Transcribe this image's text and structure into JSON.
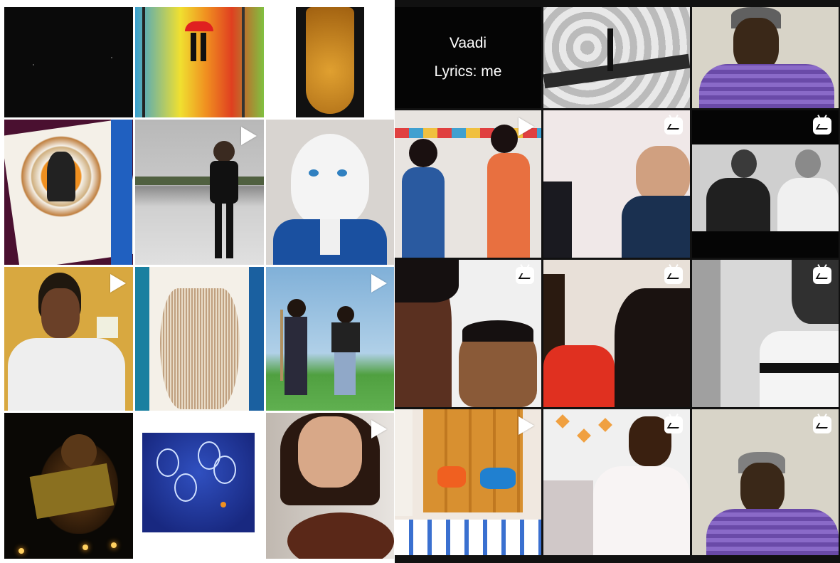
{
  "caption_tile": {
    "line1": "Vaadi",
    "line2": "Lyrics: me"
  },
  "left_tiles": [
    {
      "name": "dark-night-thumbnail",
      "badge": "none"
    },
    {
      "name": "rain-couple-painting-thumbnail",
      "badge": "none"
    },
    {
      "name": "golden-engraving-thumbnail",
      "badge": "none"
    },
    {
      "name": "mandala-art-thumbnail",
      "badge": "none"
    },
    {
      "name": "terrace-dance-video-thumbnail",
      "badge": "play"
    },
    {
      "name": "anime-portrait-drawing-thumbnail",
      "badge": "none"
    },
    {
      "name": "boy-singing-video-thumbnail",
      "badge": "play"
    },
    {
      "name": "book-fold-heart-thumbnail",
      "badge": "none"
    },
    {
      "name": "friends-lawn-video-thumbnail",
      "badge": "play"
    },
    {
      "name": "diya-lights-thumbnail",
      "badge": "none"
    },
    {
      "name": "bulb-painting-thumbnail",
      "badge": "none"
    },
    {
      "name": "girl-guitar-video-thumbnail",
      "badge": "play"
    }
  ],
  "right_tiles": [
    {
      "name": "lyrics-caption-thumbnail",
      "badge": "none"
    },
    {
      "name": "guitar-bw-thumbnail",
      "badge": "none"
    },
    {
      "name": "man-thinking-thumbnail",
      "badge": "none"
    },
    {
      "name": "two-girls-room-video-thumbnail",
      "badge": "play"
    },
    {
      "name": "video-call-igtv-thumbnail",
      "badge": "igtv"
    },
    {
      "name": "two-girls-bw-igtv-thumbnail",
      "badge": "igtv"
    },
    {
      "name": "father-son-selfie-igtv-thumbnail",
      "badge": "igtv"
    },
    {
      "name": "girls-hair-igtv-thumbnail",
      "badge": "igtv"
    },
    {
      "name": "boy-striped-shirt-igtv-thumbnail",
      "badge": "igtv"
    },
    {
      "name": "dance-duo-video-thumbnail",
      "badge": "play"
    },
    {
      "name": "girl-singing-igtv-thumbnail",
      "badge": "igtv"
    },
    {
      "name": "man-thinking-igtv-thumbnail",
      "badge": "igtv"
    }
  ],
  "colors": {
    "play_icon": "#ffffff",
    "igtv_icon": "#ffffff",
    "panel_divider": "#ffffff"
  }
}
